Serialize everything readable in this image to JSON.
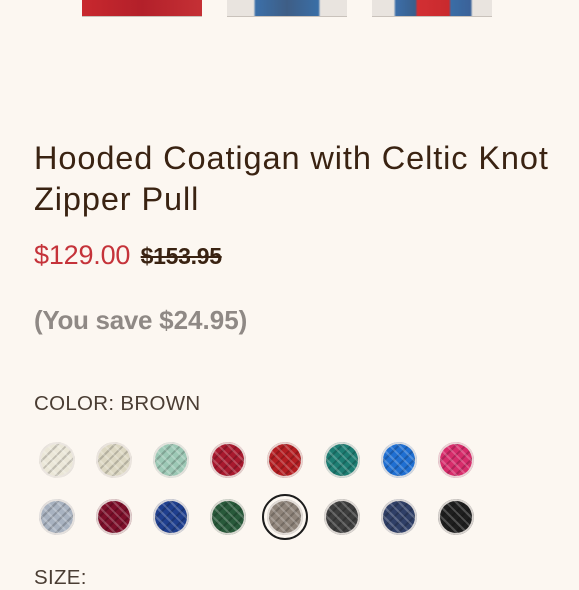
{
  "product": {
    "title": "Hooded Coatigan with Celtic Knot Zipper Pull",
    "price_sale": "$129.00",
    "price_original": "$153.95",
    "save_prefix": "(You save ",
    "save_amount": "$24.95",
    "save_suffix": ")"
  },
  "color": {
    "label_prefix": "COLOR: ",
    "selected": "BROWN",
    "swatch_colors": [
      "#ebe7d8",
      "#dcd7c2",
      "#9cc8b5",
      "#a8192e",
      "#b41e22",
      "#1d7d72",
      "#1f6fd2",
      "#d72c6b",
      "#a8b2c0",
      "#7d0f2a",
      "#1f3f8e",
      "#28593a",
      "#8e8379",
      "#3e3e3e",
      "#2f3f67",
      "#1e1e1e"
    ],
    "selected_index": 12
  },
  "size": {
    "label": "SIZE:"
  },
  "thumbnails": [
    "thumbnail-1",
    "thumbnail-2",
    "thumbnail-3"
  ]
}
